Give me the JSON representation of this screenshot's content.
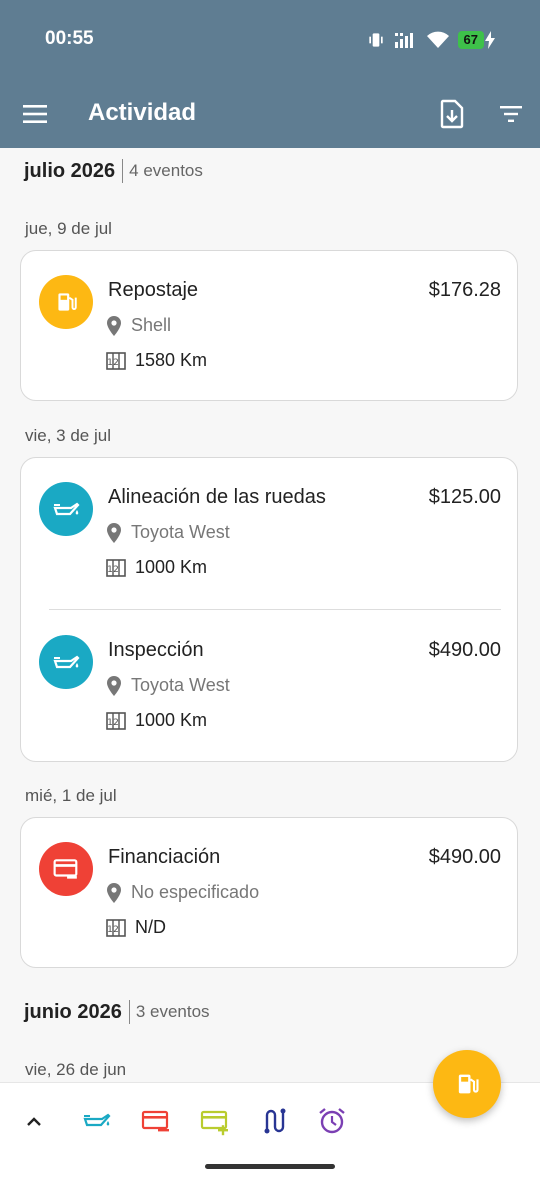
{
  "status": {
    "time": "00:55",
    "battery": "67"
  },
  "toolbar": {
    "title": "Actividad"
  },
  "colors": {
    "appbar": "#5f7d92",
    "fuel": "#fdb813",
    "service": "#1aa9c4",
    "expense": "#ef4136",
    "income": "#b9cc2e",
    "route": "#283593",
    "reminder": "#7b3fb3"
  },
  "sections": [
    {
      "month": "julio 2026",
      "count": "4 eventos"
    },
    {
      "month": "junio 2026",
      "count": "3 eventos"
    }
  ],
  "days": [
    {
      "label": "jue, 9 de jul"
    },
    {
      "label": "vie, 3 de jul"
    },
    {
      "label": "mié, 1 de jul"
    },
    {
      "label": "vie, 26 de jun"
    }
  ],
  "entries": [
    {
      "title": "Repostaje",
      "amount": "$176.28",
      "place": "Shell",
      "odometer": "1580 Km",
      "icon": "fuel-pump-icon"
    },
    {
      "title": "Alineación de las ruedas",
      "amount": "$125.00",
      "place": "Toyota West",
      "odometer": "1000 Km",
      "icon": "oil-can-icon"
    },
    {
      "title": "Inspección",
      "amount": "$490.00",
      "place": "Toyota West",
      "odometer": "1000 Km",
      "icon": "oil-can-icon"
    },
    {
      "title": "Financiación",
      "amount": "$490.00",
      "place": "No especificado",
      "odometer": "N/D",
      "icon": "card-minus-icon"
    }
  ]
}
